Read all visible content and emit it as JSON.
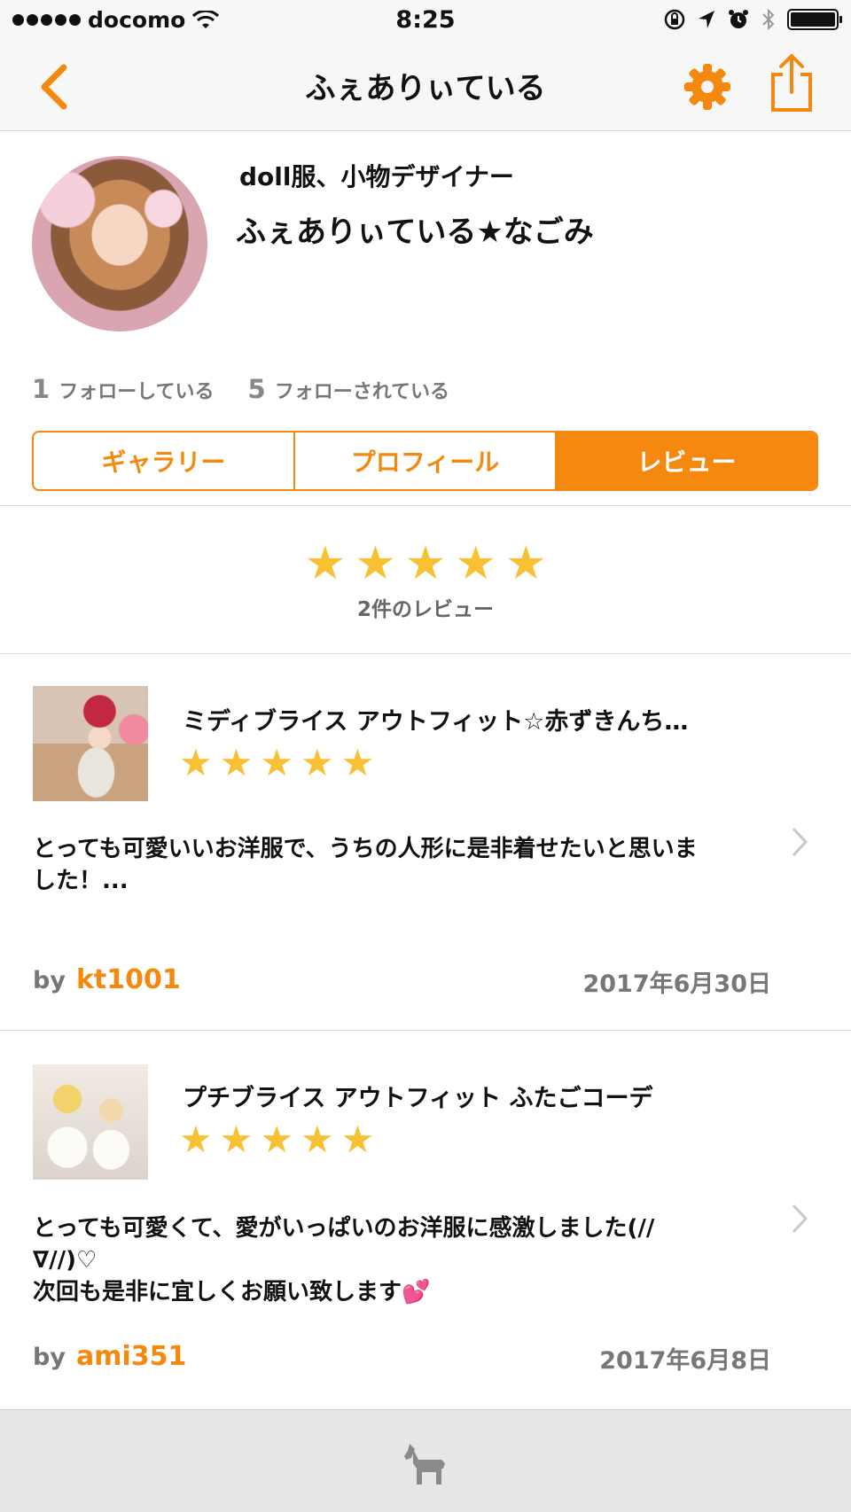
{
  "status_bar": {
    "carrier": "docomo",
    "time": "8:25",
    "icons": [
      "signal-dots",
      "wifi-icon",
      "lock-rotation-icon",
      "location-arrow-icon",
      "alarm-icon",
      "bluetooth-icon",
      "battery-icon"
    ]
  },
  "nav": {
    "title": "ふぇありぃている",
    "back_icon": "chevron-left-icon",
    "settings_icon": "gear-icon",
    "share_icon": "share-icon",
    "accent_color": "#f5890f"
  },
  "profile": {
    "role": "doll服、小物デザイナー",
    "name": "ふぇありぃている★なごみ",
    "following_count": "1",
    "following_label": "フォローしている",
    "followers_count": "5",
    "followers_label": "フォローされている"
  },
  "tabs": [
    {
      "label": "ギャラリー",
      "active": false
    },
    {
      "label": "プロフィール",
      "active": false
    },
    {
      "label": "レビュー",
      "active": true
    }
  ],
  "summary": {
    "rating": 5,
    "max_rating": 5,
    "count_text": "2件のレビュー",
    "star_color": "#f8c033"
  },
  "reviews": [
    {
      "title": "ミディブライス アウトフィット☆赤ずきんち…",
      "rating": 5,
      "body": "とっても可愛いいお洋服で、うちの人形に是非着せたいと思いま\nした！...",
      "by_label": "by",
      "user": "kt1001",
      "date": "2017年6月30日"
    },
    {
      "title": "プチブライス アウトフィット ふたごコーデ",
      "rating": 5,
      "body": "とっても可愛くて、愛がいっぱいのお洋服に感激しました(//\n∇//)♡\n次回も是非に宜しくお願い致します💕",
      "by_label": "by",
      "user": "ami351",
      "date": "2017年6月8日"
    }
  ],
  "bottom_bar": {
    "icon": "horse-icon"
  }
}
